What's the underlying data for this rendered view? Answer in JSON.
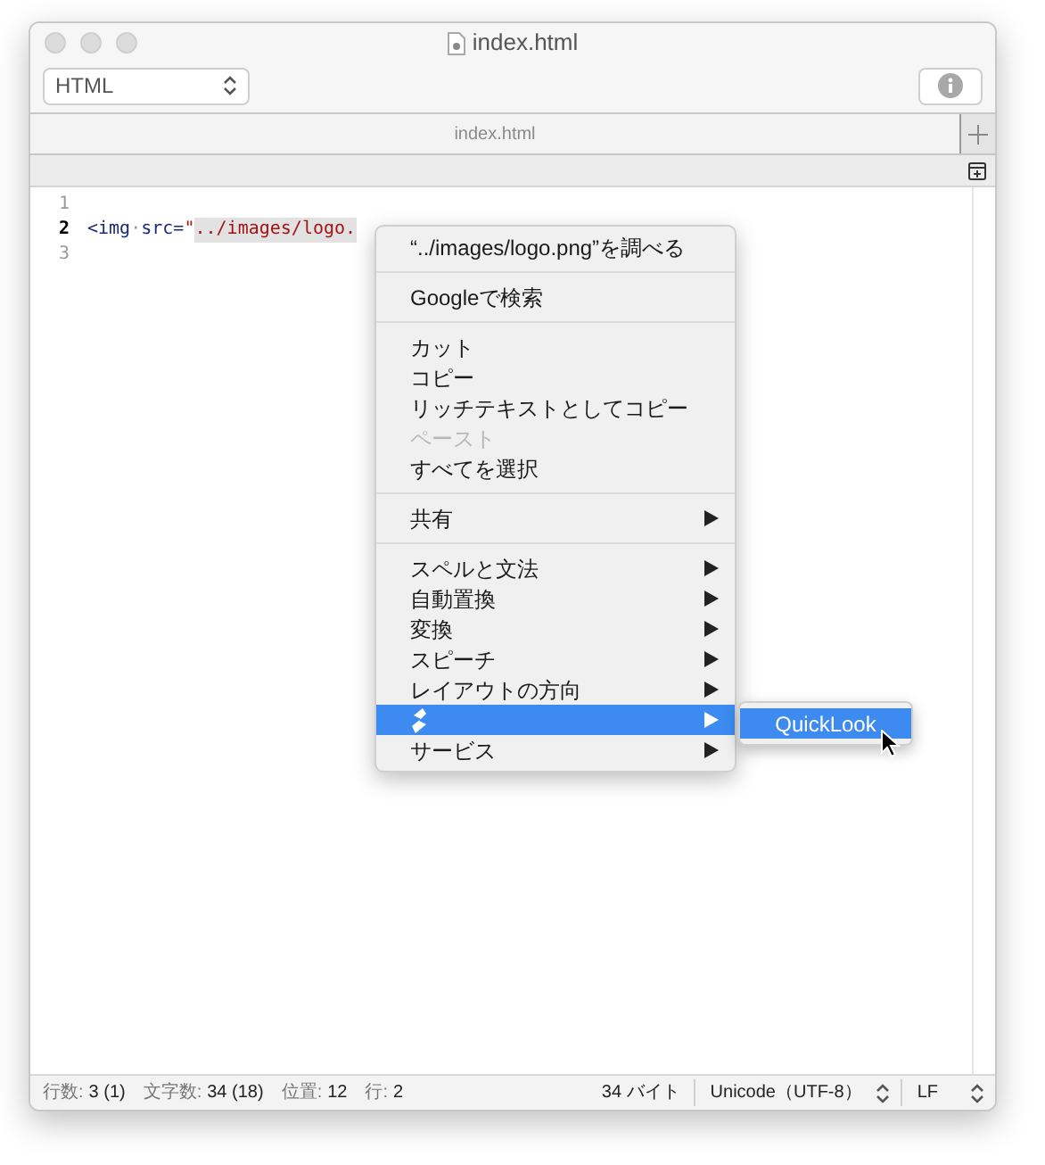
{
  "window": {
    "title": "index.html"
  },
  "toolbar": {
    "syntax": "HTML"
  },
  "tabs": [
    {
      "label": "index.html",
      "selected": true
    }
  ],
  "editor": {
    "lines": [
      {
        "number": "1",
        "current": false
      },
      {
        "number": "2",
        "current": true,
        "segments": [
          {
            "kind": "tag",
            "text": "<img"
          },
          {
            "kind": "space",
            "text": "·"
          },
          {
            "kind": "attr",
            "text": "src="
          },
          {
            "kind": "string",
            "text": "\"",
            "selected": false
          },
          {
            "kind": "string",
            "text": "../images/logo.",
            "selected": true
          }
        ]
      },
      {
        "number": "3",
        "current": false
      }
    ]
  },
  "context_menu": {
    "items": [
      {
        "kind": "item",
        "label": "“../images/logo.png”を調べる",
        "disabled": false,
        "submenu": false,
        "selected": false
      },
      {
        "kind": "separator"
      },
      {
        "kind": "item",
        "label": "Googleで検索",
        "disabled": false,
        "submenu": false,
        "selected": false
      },
      {
        "kind": "separator"
      },
      {
        "kind": "item",
        "label": "カット",
        "disabled": false,
        "submenu": false,
        "selected": false
      },
      {
        "kind": "item",
        "label": "コピー",
        "disabled": false,
        "submenu": false,
        "selected": false
      },
      {
        "kind": "item",
        "label": "リッチテキストとしてコピー",
        "disabled": false,
        "submenu": false,
        "selected": false
      },
      {
        "kind": "item",
        "label": "ペースト",
        "disabled": true,
        "submenu": false,
        "selected": false
      },
      {
        "kind": "item",
        "label": "すべてを選択",
        "disabled": false,
        "submenu": false,
        "selected": false
      },
      {
        "kind": "separator"
      },
      {
        "kind": "item",
        "label": "共有",
        "disabled": false,
        "submenu": true,
        "selected": false
      },
      {
        "kind": "separator"
      },
      {
        "kind": "item",
        "label": "スペルと文法",
        "disabled": false,
        "submenu": true,
        "selected": false
      },
      {
        "kind": "item",
        "label": "自動置換",
        "disabled": false,
        "submenu": true,
        "selected": false
      },
      {
        "kind": "item",
        "label": "変換",
        "disabled": false,
        "submenu": true,
        "selected": false
      },
      {
        "kind": "item",
        "label": "スピーチ",
        "disabled": false,
        "submenu": true,
        "selected": false
      },
      {
        "kind": "item",
        "label": "レイアウトの方向",
        "disabled": false,
        "submenu": true,
        "selected": false
      },
      {
        "kind": "icon",
        "submenu": true,
        "selected": true
      },
      {
        "kind": "item",
        "label": "サービス",
        "disabled": false,
        "submenu": true,
        "selected": false
      }
    ],
    "submenu": [
      {
        "label": "QuickLook",
        "selected": true
      }
    ]
  },
  "status_bar": {
    "fields": [
      {
        "label": "行数:",
        "value": "3 (1)"
      },
      {
        "label": "文字数:",
        "value": "34 (18)"
      },
      {
        "label": "位置:",
        "value": "12"
      },
      {
        "label": "行:",
        "value": "2"
      }
    ],
    "size": "34 バイト",
    "encoding": "Unicode（UTF-8）",
    "line_ending": "LF"
  }
}
